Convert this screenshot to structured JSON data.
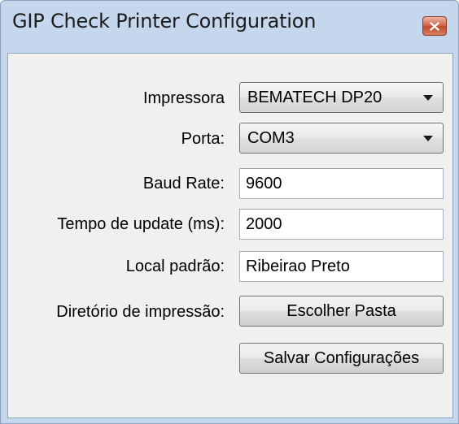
{
  "window": {
    "title": "GIP Check Printer Configuration",
    "close_icon": "close-icon"
  },
  "form": {
    "printer": {
      "label": "Impressora",
      "value": "BEMATECH DP20"
    },
    "port": {
      "label": "Porta:",
      "value": "COM3"
    },
    "baud_rate": {
      "label": "Baud Rate:",
      "value": "9600"
    },
    "update_time": {
      "label": "Tempo de update (ms):",
      "value": "2000"
    },
    "default_location": {
      "label": "Local padrão:",
      "value": "Ribeirao Preto"
    },
    "print_directory": {
      "label": "Diretório de impressão:",
      "button_label": "Escolher Pasta"
    },
    "save_button_label": "Salvar Configurações"
  },
  "colors": {
    "frame": "#c5d7ec",
    "client_background": "#f0f0f0",
    "close_button": "#c24a2c"
  }
}
